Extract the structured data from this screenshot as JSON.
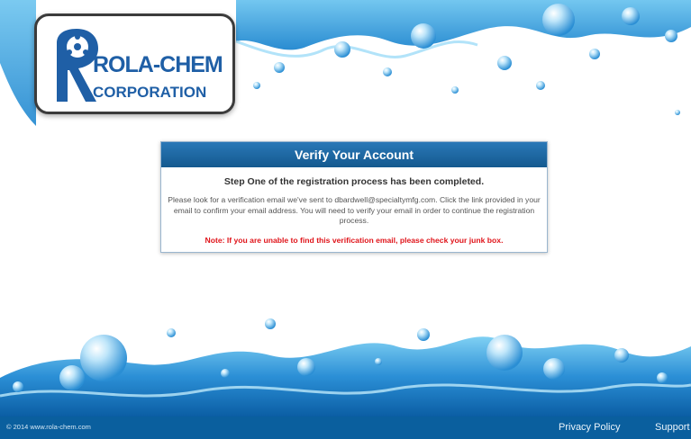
{
  "logo": {
    "brand_name": "ROLA-CHEM",
    "brand_subtitle": "CORPORATION"
  },
  "verify": {
    "title": "Verify Your Account",
    "step": "Step One of the registration process has been completed.",
    "instructions": "Please look for a verification email we've sent to dbardwell@specialtymfg.com. Click the link provided in your email to confirm your email address. You will need to verify your email in order to continue the registration process.",
    "note": "Note: If you are unable to find this verification email, please check your junk box."
  },
  "footer": {
    "copyright": "© 2014 www.rola-chem.com",
    "privacy_label": "Privacy Policy",
    "support_label": "Support"
  },
  "colors": {
    "header_blue": "#1a66a3",
    "footer_blue": "#0a5f9e",
    "note_red": "#e0141a",
    "water_blue": "#3fa7e0"
  }
}
